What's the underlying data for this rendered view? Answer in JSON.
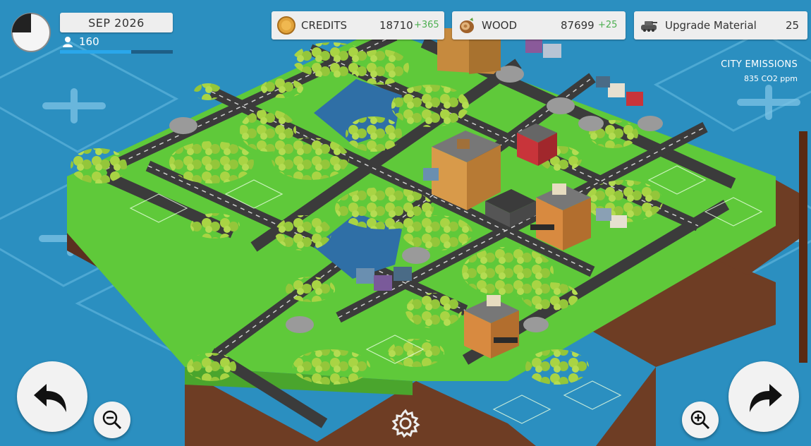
{
  "hud": {
    "date": "SEP 2026",
    "population": "160",
    "population_progress": 0.63
  },
  "resources": {
    "credits": {
      "label": "CREDITS",
      "value": "18710",
      "delta": "+365",
      "icon": "coin-icon"
    },
    "wood": {
      "label": "WOOD",
      "value": "87699",
      "delta": "+25",
      "icon": "wood-log-icon"
    },
    "upgrade": {
      "label": "Upgrade Material",
      "value": "25",
      "icon": "tank-icon"
    }
  },
  "emissions": {
    "title": "CITY EMISSIONS",
    "value": "835 CO2 ppm"
  },
  "controls": {
    "rotate_left": "rotate-left-icon",
    "rotate_right": "rotate-right-icon",
    "zoom_out": "zoom-out-icon",
    "zoom_in": "zoom-in-icon",
    "settings": "gear-icon"
  },
  "colors": {
    "water": "#2b8fc0",
    "grass": "#5fc93a",
    "road": "#3a3a3a",
    "soil": "#6e3d24",
    "tree": "#9ccc3c",
    "positive": "#4caf50"
  }
}
